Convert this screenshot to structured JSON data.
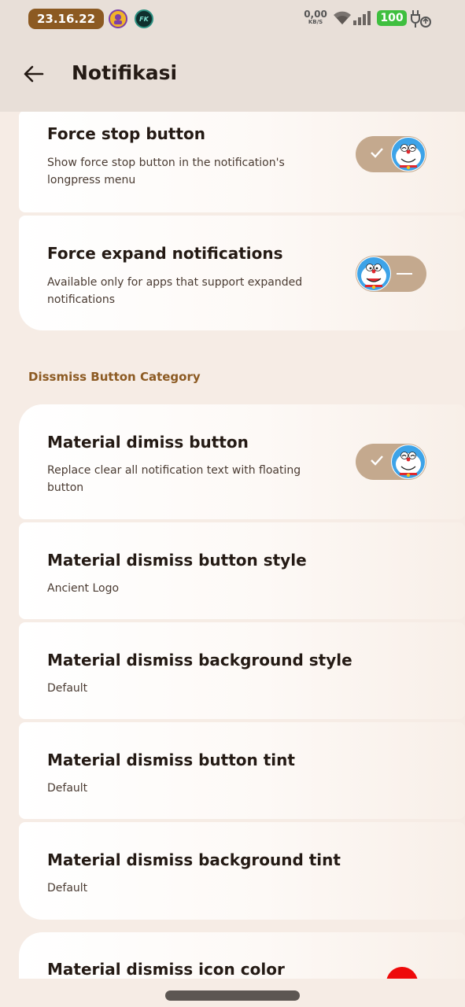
{
  "status_bar": {
    "time": "23.16.22",
    "avatar_2_text": "FK",
    "net_speed_value": "0,00",
    "net_speed_unit": "KB/S",
    "battery": "100"
  },
  "app_bar": {
    "title": "Notifikasi"
  },
  "items_group_1": [
    {
      "title": "Force stop button",
      "subtitle": "Show force stop button in the notification's longpress menu",
      "toggle": "on"
    },
    {
      "title": "Force expand notifications",
      "subtitle": "Available only for apps that support expanded notifications",
      "toggle": "off"
    }
  ],
  "section_header": "Dissmiss Button Category",
  "items_group_2": [
    {
      "title": "Material dimiss button",
      "subtitle": "Replace clear all notification text with floating button",
      "toggle": "on"
    },
    {
      "title": "Material dismiss button style",
      "subtitle": "Ancient Logo"
    },
    {
      "title": "Material dismiss background style",
      "subtitle": "Default"
    },
    {
      "title": "Material dismiss button tint",
      "subtitle": "Default"
    },
    {
      "title": "Material dismiss background tint",
      "subtitle": "Default"
    }
  ],
  "items_group_3": [
    {
      "title": "Material dismiss icon color",
      "color": "#ee0a0a"
    }
  ],
  "colors": {
    "accent": "#8c5a22",
    "toggle_track": "#c4a98e",
    "background": "#f6ece5"
  }
}
